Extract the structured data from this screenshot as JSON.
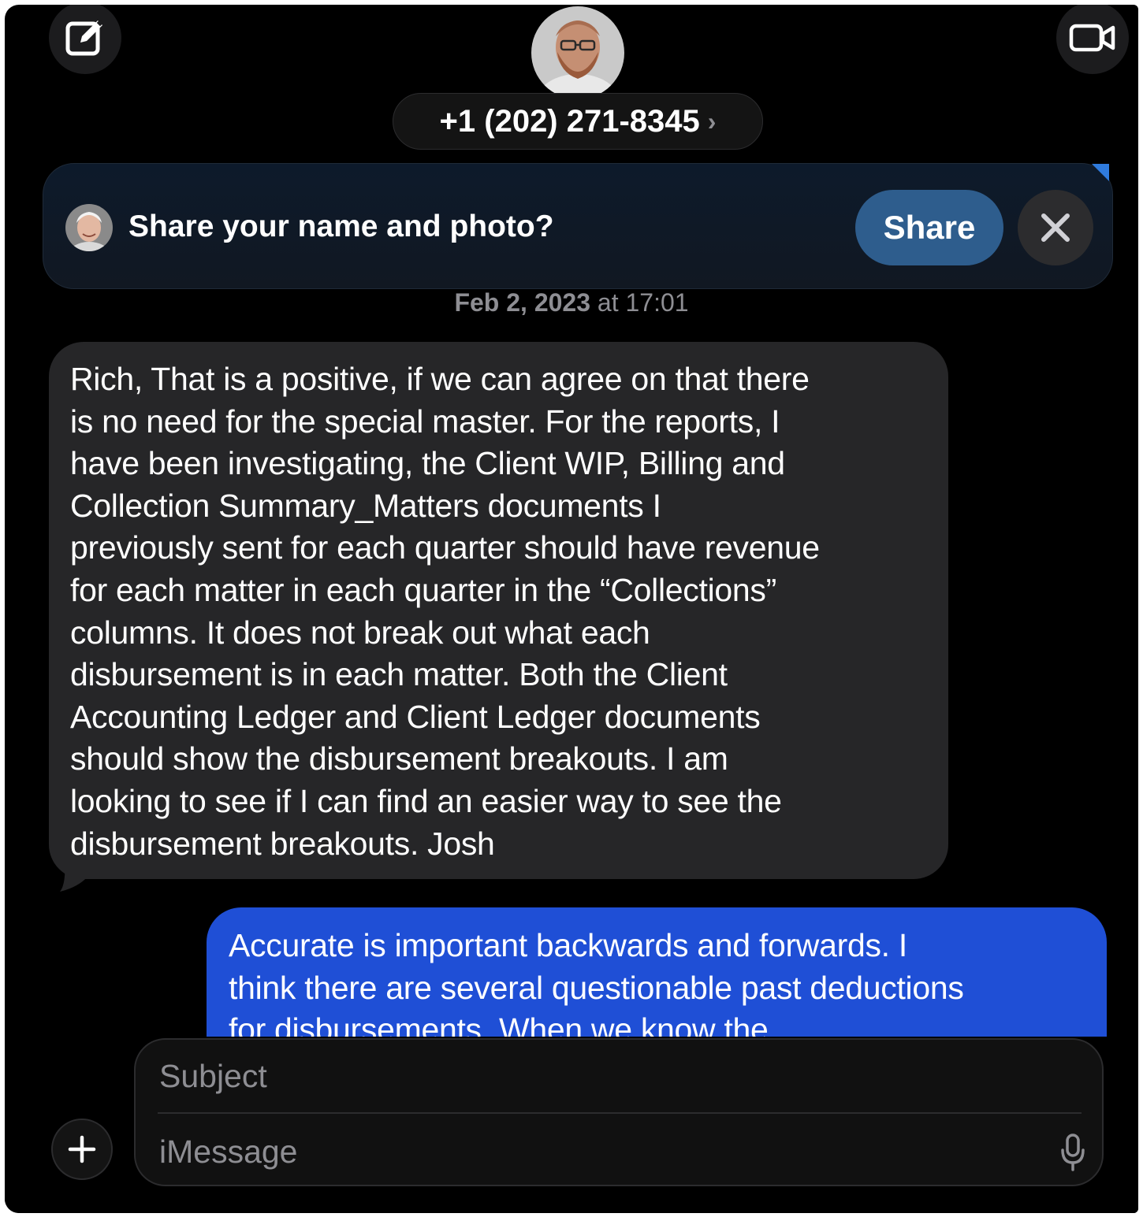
{
  "header": {
    "contact_number": "+1 (202) 271-8345",
    "contact_chevron": "›",
    "compose_icon": "compose-icon",
    "video_icon": "video-camera-icon"
  },
  "share_banner": {
    "prompt": "Share your name and photo?",
    "share_label": "Share",
    "close_icon": "close-icon"
  },
  "conversation": {
    "timestamp_date": "Feb 2, 2023",
    "timestamp_time": "at 17:01",
    "messages": [
      {
        "direction": "incoming",
        "text": "Rich, That is a positive, if we can agree on that there\nis no need for the special master. For the reports, I\nhave been investigating, the Client WIP, Billing and\nCollection Summary_Matters documents I\npreviously sent for each quarter should have revenue\nfor each matter in each quarter in the “Collections”\ncolumns. It does not break out what each\ndisbursement is in each matter. Both the Client\nAccounting Ledger and Client Ledger documents\nshould show the disbursement breakouts. I am\nlooking to see if I can find an easier way to see the\ndisbursement breakouts. Josh"
      },
      {
        "direction": "outgoing",
        "text": "Accurate is important backwards and forwards. I\nthink there are several questionable past deductions\nfor disbursements. When we know the"
      }
    ]
  },
  "composer": {
    "subject_placeholder": "Subject",
    "message_placeholder": "iMessage",
    "plus_icon": "plus-icon",
    "mic_icon": "microphone-icon"
  },
  "colors": {
    "background": "#000000",
    "incoming_bubble": "#262628",
    "outgoing_bubble": "#1f4fd6",
    "share_button": "#2e5d8d",
    "secondary_text": "#8e8e93"
  }
}
